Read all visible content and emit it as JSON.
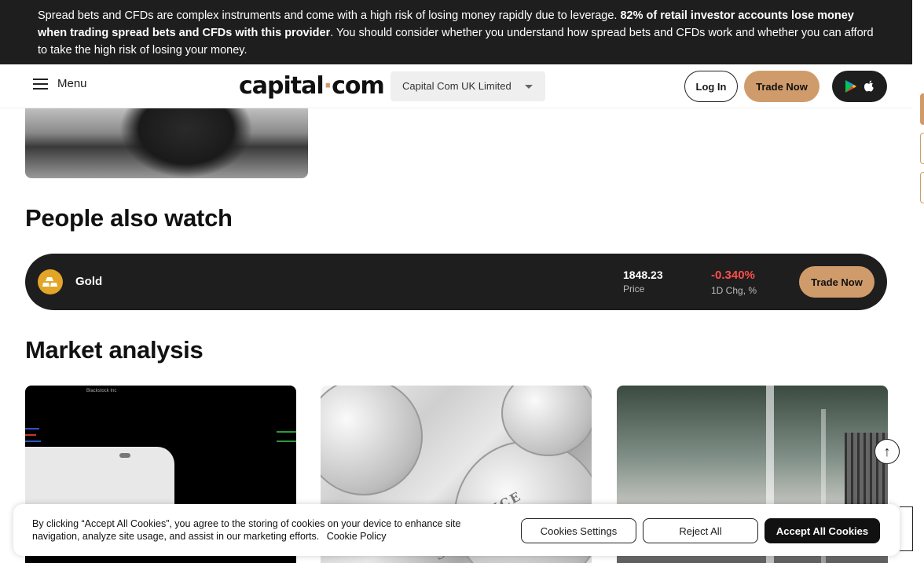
{
  "risk_banner": {
    "text_1": "Spread bets and CFDs are complex instruments and come with a high risk of losing money rapidly due to leverage. ",
    "text_bold": "82% of retail investor accounts lose money when trading spread bets and CFDs with this provider",
    "text_2": ". You should consider whether you understand how spread bets and CFDs work and whether you can afford to take the high risk of losing your money."
  },
  "header": {
    "menu_label": "Menu",
    "logo_part1": "capital",
    "logo_dot": "·",
    "logo_part2": "com",
    "entity_select": "Capital Com UK Limited",
    "login_label": "Log In",
    "trade_label": "Trade Now"
  },
  "sections": {
    "people_also_watch": "People also watch",
    "market_analysis": "Market analysis"
  },
  "watchlist": [
    {
      "name": "Gold",
      "price": "1848.23",
      "price_label": "Price",
      "change": "-0.340%",
      "change_label": "1D Chg, %",
      "trade_label": "Trade Now",
      "change_color": "#ff4d4d"
    }
  ],
  "cards": {
    "card1_header": "Blackstock Inc",
    "card2_text": "ONE OUNCE SILVER"
  },
  "cookie": {
    "text": "By clicking “Accept All Cookies”, you agree to the storing of cookies on your device to enhance site navigation, analyze site usage, and assist in our marketing efforts.",
    "policy_link": "Cookie Policy",
    "settings_label": "Cookies Settings",
    "reject_label": "Reject All",
    "accept_label": "Accept All Cookies"
  },
  "colors": {
    "accent": "#d09b6b",
    "dark": "#1e1e1e",
    "negative": "#ff4d4d"
  },
  "icons": [
    "hamburger-icon",
    "caret-down-icon",
    "google-play-icon",
    "apple-icon",
    "gold-bars-icon",
    "arrow-up-icon"
  ]
}
